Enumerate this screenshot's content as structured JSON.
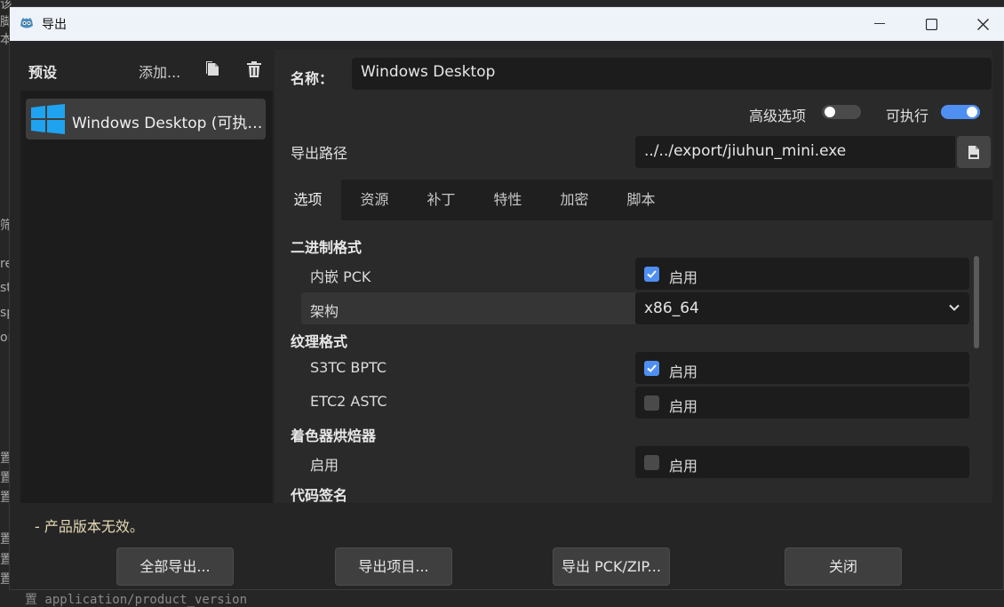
{
  "background": {
    "left_glyphs": [
      "该脚本",
      "筛",
      "re",
      "st",
      "sp",
      "or",
      "置",
      "置",
      "置",
      "置",
      "置",
      "置"
    ],
    "bottom_text": "置 application/product_version"
  },
  "window": {
    "title": "导出",
    "titlebar_bg": "#eef2f9",
    "accent": "#4f8ff2"
  },
  "presets": {
    "label": "预设",
    "add_label": "添加...",
    "items": [
      {
        "label": "Windows Desktop (可执…"
      }
    ]
  },
  "details": {
    "name_label": "名称：",
    "name_value": "Windows Desktop",
    "advanced_label": "高级选项",
    "advanced_on": false,
    "runnable_label": "可执行",
    "runnable_on": true,
    "export_path_label": "导出路径",
    "export_path_value": "../../export/jiuhun_mini.exe"
  },
  "tabs": [
    {
      "label": "选项",
      "active": true
    },
    {
      "label": "资源",
      "active": false
    },
    {
      "label": "补丁",
      "active": false
    },
    {
      "label": "特性",
      "active": false
    },
    {
      "label": "加密",
      "active": false
    },
    {
      "label": "脚本",
      "active": false
    }
  ],
  "options": {
    "binary_format": {
      "title": "二进制格式",
      "embed_pck_label": "内嵌 PCK",
      "embed_pck_value": "启用",
      "embed_pck_checked": true,
      "arch_label": "架构",
      "arch_value": "x86_64"
    },
    "texture_format": {
      "title": "纹理格式",
      "s3tc_label": "S3TC BPTC",
      "s3tc_value": "启用",
      "s3tc_checked": true,
      "etc2_label": "ETC2 ASTC",
      "etc2_value": "启用",
      "etc2_checked": false
    },
    "shader_baker": {
      "title": "着色器烘焙器",
      "enabled_label": "启用",
      "enabled_value": "启用",
      "enabled_checked": false
    },
    "code_signing": {
      "title": "代码签名"
    }
  },
  "warning": "- 产品版本无效。",
  "buttons": {
    "export_all": "全部导出...",
    "export_project": "导出项目...",
    "export_pck": "导出 PCK/ZIP...",
    "close": "关闭"
  }
}
